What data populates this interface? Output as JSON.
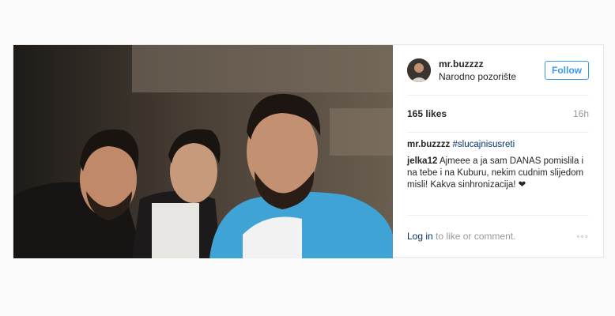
{
  "post": {
    "photo_icon": "group-selfie-photo",
    "header": {
      "avatar_icon": "profile-avatar",
      "username": "mr.buzzzz",
      "location": "Narodno pozorište",
      "follow_label": "Follow"
    },
    "likes": "165 likes",
    "time_ago": "16h",
    "caption": {
      "username": "mr.buzzzz",
      "hashtag": "#slucajnisusreti"
    },
    "comments": [
      {
        "username": "jelka12",
        "text": "Ajmeee a ja sam DANAS pomislila i na tebe i na Kuburu, nekim cudnim slijedom misli! Kakva sinhronizacija! ❤"
      }
    ],
    "footer": {
      "login_text": "Log in",
      "suffix_text": " to like or comment.",
      "more_icon": "◦◦◦"
    }
  },
  "colors": {
    "accent": "#3897f0",
    "link": "#003569",
    "muted": "#999999"
  }
}
